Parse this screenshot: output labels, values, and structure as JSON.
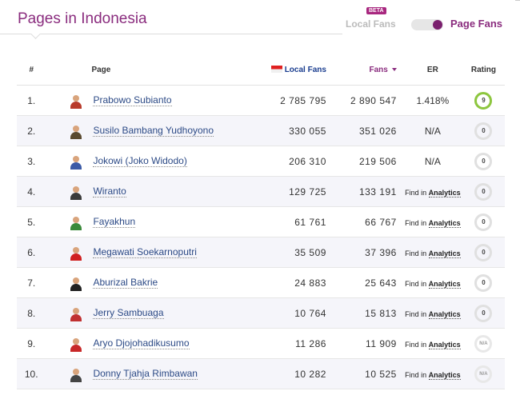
{
  "header": {
    "title": "Pages in Indonesia",
    "beta_badge": "BETA",
    "toggle_left": "Local Fans",
    "toggle_right": "Page Fans"
  },
  "table": {
    "columns": {
      "rank": "#",
      "page": "Page",
      "local_fans": "Local Fans",
      "fans": "Fans",
      "er": "ER",
      "rating": "Rating"
    },
    "rows": [
      {
        "rank": "1.",
        "name": "Prabowo Subianto",
        "local_fans": "2 785 795",
        "fans": "2 890 547",
        "er": "1.418%",
        "er_link": "",
        "rating": "9",
        "rating_full": true,
        "avatar_color": "#b83a2a"
      },
      {
        "rank": "2.",
        "name": "Susilo Bambang Yudhoyono",
        "local_fans": "330 055",
        "fans": "351 026",
        "er": "N/A",
        "er_link": "",
        "rating": "0",
        "rating_full": false,
        "avatar_color": "#5a4a30"
      },
      {
        "rank": "3.",
        "name": "Jokowi (Joko Widodo)",
        "local_fans": "206 310",
        "fans": "219 506",
        "er": "N/A",
        "er_link": "",
        "rating": "0",
        "rating_full": false,
        "avatar_color": "#3b5aa6"
      },
      {
        "rank": "4.",
        "name": "Wiranto",
        "local_fans": "129 725",
        "fans": "133 191",
        "er": "Find in ",
        "er_link": "Analytics",
        "rating": "0",
        "rating_full": false,
        "avatar_color": "#3a3a3a"
      },
      {
        "rank": "5.",
        "name": "Fayakhun",
        "local_fans": "61 761",
        "fans": "66 767",
        "er": "Find in ",
        "er_link": "Analytics",
        "rating": "0",
        "rating_full": false,
        "avatar_color": "#3a8a3a"
      },
      {
        "rank": "6.",
        "name": "Megawati Soekarnoputri",
        "local_fans": "35 509",
        "fans": "37 396",
        "er": "Find in ",
        "er_link": "Analytics",
        "rating": "0",
        "rating_full": false,
        "avatar_color": "#d02020"
      },
      {
        "rank": "7.",
        "name": "Aburizal Bakrie",
        "local_fans": "24 883",
        "fans": "25 643",
        "er": "Find in ",
        "er_link": "Analytics",
        "rating": "0",
        "rating_full": false,
        "avatar_color": "#222222"
      },
      {
        "rank": "8.",
        "name": "Jerry Sambuaga",
        "local_fans": "10 764",
        "fans": "15 813",
        "er": "Find in ",
        "er_link": "Analytics",
        "rating": "0",
        "rating_full": false,
        "avatar_color": "#c03030"
      },
      {
        "rank": "9.",
        "name": "Aryo Djojohadikusumo",
        "local_fans": "11 286",
        "fans": "11 909",
        "er": "Find in ",
        "er_link": "Analytics",
        "rating": "N/A",
        "rating_full": false,
        "avatar_color": "#c82828"
      },
      {
        "rank": "10.",
        "name": "Donny Tjahja Rimbawan",
        "local_fans": "10 282",
        "fans": "10 525",
        "er": "Find in ",
        "er_link": "Analytics",
        "rating": "N/A",
        "rating_full": false,
        "avatar_color": "#444444"
      }
    ]
  }
}
